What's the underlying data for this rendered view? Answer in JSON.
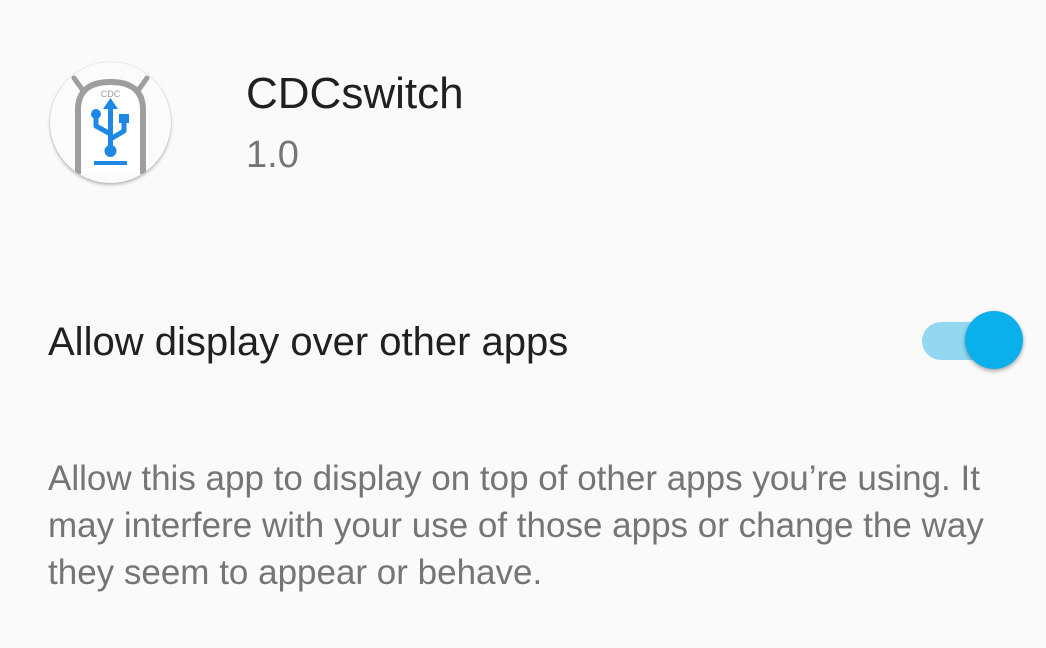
{
  "app": {
    "name": "CDCswitch",
    "version": "1.0",
    "icon": "android-usb-icon",
    "icon_label": "CDC"
  },
  "setting": {
    "title": "Allow display over other apps",
    "enabled": true,
    "summary": "Allow this app to display on top of other apps you’re using. It may interfere with your use of those apps or change the way they seem to appear or behave."
  },
  "colors": {
    "background": "#fafafa",
    "toggle_thumb": "#0ab0ec",
    "toggle_track": "#93d8f0",
    "icon_blue": "#1e88e5",
    "icon_gray": "#9e9e9e"
  }
}
